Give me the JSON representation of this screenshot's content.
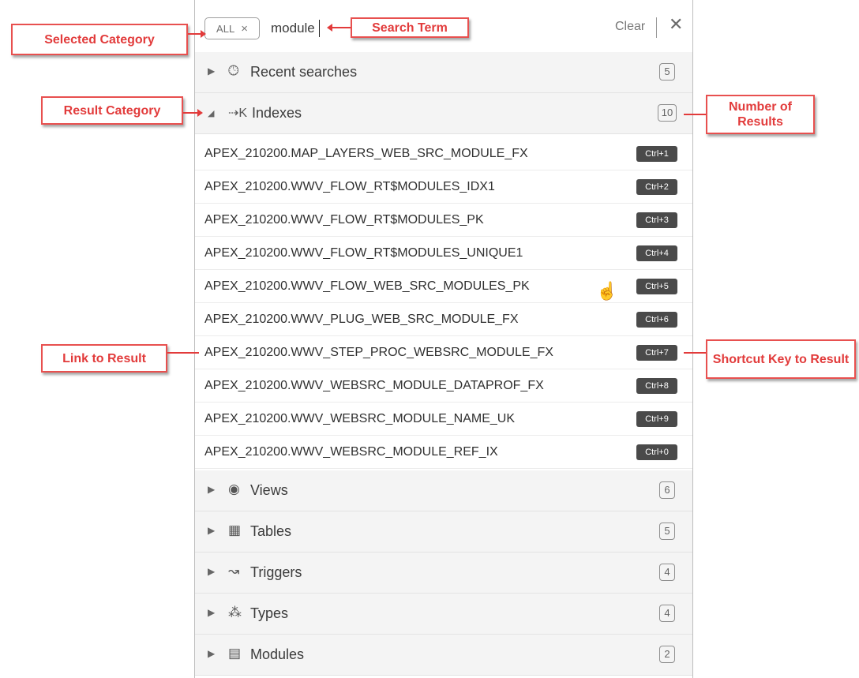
{
  "search": {
    "category_chip": "ALL",
    "chip_close": "×",
    "query": "module",
    "clear_label": "Clear",
    "close_label": "✕"
  },
  "categories_top": [
    {
      "label": "Recent searches",
      "icon": "clock-icon",
      "count": "5",
      "expanded": false
    },
    {
      "label": "Indexes",
      "icon": "index-icon",
      "count": "10",
      "expanded": true
    }
  ],
  "results": [
    {
      "label": "APEX_210200.MAP_LAYERS_WEB_SRC_MODULE_FX",
      "shortcut": "Ctrl+1"
    },
    {
      "label": "APEX_210200.WWV_FLOW_RT$MODULES_IDX1",
      "shortcut": "Ctrl+2"
    },
    {
      "label": "APEX_210200.WWV_FLOW_RT$MODULES_PK",
      "shortcut": "Ctrl+3"
    },
    {
      "label": "APEX_210200.WWV_FLOW_RT$MODULES_UNIQUE1",
      "shortcut": "Ctrl+4"
    },
    {
      "label": "APEX_210200.WWV_FLOW_WEB_SRC_MODULES_PK",
      "shortcut": "Ctrl+5"
    },
    {
      "label": "APEX_210200.WWV_PLUG_WEB_SRC_MODULE_FX",
      "shortcut": "Ctrl+6"
    },
    {
      "label": "APEX_210200.WWV_STEP_PROC_WEBSRC_MODULE_FX",
      "shortcut": "Ctrl+7"
    },
    {
      "label": "APEX_210200.WWV_WEBSRC_MODULE_DATAPROF_FX",
      "shortcut": "Ctrl+8"
    },
    {
      "label": "APEX_210200.WWV_WEBSRC_MODULE_NAME_UK",
      "shortcut": "Ctrl+9"
    },
    {
      "label": "APEX_210200.WWV_WEBSRC_MODULE_REF_IX",
      "shortcut": "Ctrl+0"
    }
  ],
  "categories_bottom": [
    {
      "label": "Views",
      "icon": "eye-icon",
      "count": "6"
    },
    {
      "label": "Tables",
      "icon": "table-icon",
      "count": "5"
    },
    {
      "label": "Triggers",
      "icon": "trigger-icon",
      "count": "4"
    },
    {
      "label": "Types",
      "icon": "types-icon",
      "count": "4"
    },
    {
      "label": "Modules",
      "icon": "module-icon",
      "count": "2"
    }
  ],
  "annotations": {
    "selected_category": "Selected Category",
    "search_term": "Search Term",
    "result_category": "Result Category",
    "number_of_results": "Number of Results",
    "link_to_result": "Link to Result",
    "shortcut_key": "Shortcut Key to Result",
    "color": "#e23b3b"
  }
}
